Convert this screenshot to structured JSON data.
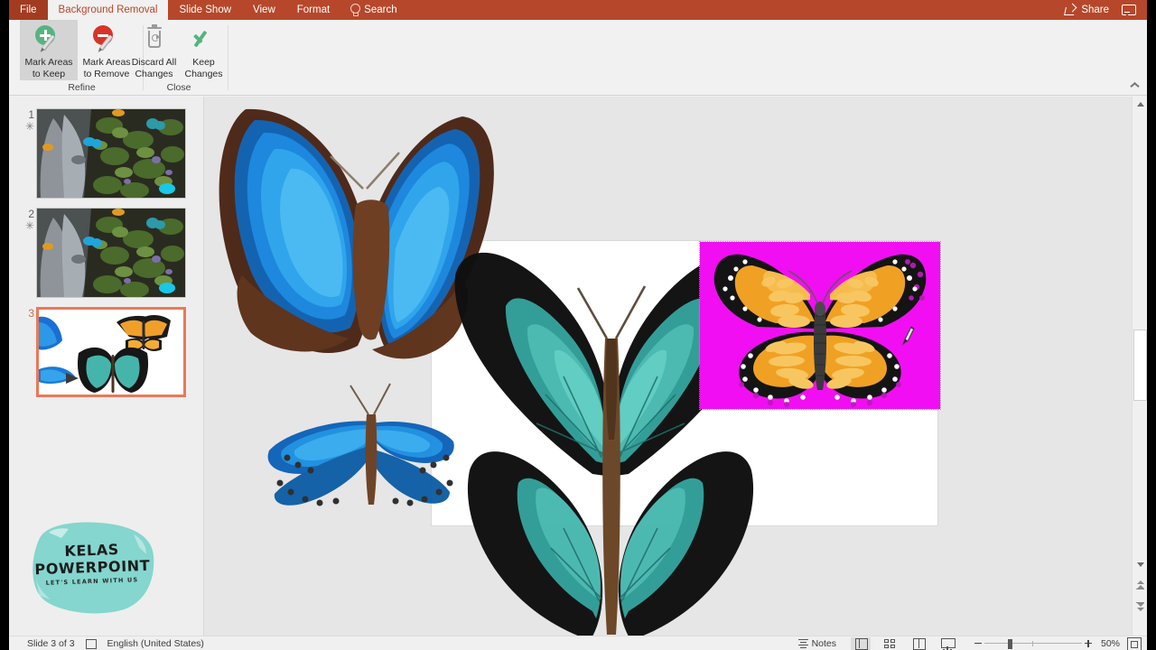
{
  "app": {
    "title": "Microsoft PowerPoint",
    "theme_color": "#b7472a",
    "accent_color": "#e8795a"
  },
  "tabs": [
    {
      "label": "File",
      "type": "file",
      "active": false
    },
    {
      "label": "Background Removal",
      "type": "normal",
      "active": true
    },
    {
      "label": "Slide Show",
      "type": "normal",
      "active": false
    },
    {
      "label": "View",
      "type": "normal",
      "active": false
    },
    {
      "label": "Format",
      "type": "normal",
      "active": false
    },
    {
      "label": "Search",
      "type": "search",
      "active": false,
      "icon": "lightbulb-icon"
    }
  ],
  "titlebar_right": {
    "share_label": "Share",
    "share_icon": "share-icon",
    "comments_icon": "comment-icon"
  },
  "ribbon": {
    "collapse_icon": "chevron-up-icon",
    "groups": [
      {
        "name": "Refine",
        "label": "Refine",
        "buttons": [
          {
            "label_line1": "Mark Areas",
            "label_line2": "to Keep",
            "icon": "mark-keep-icon",
            "selected": true
          },
          {
            "label_line1": "Mark Areas",
            "label_line2": "to Remove",
            "icon": "mark-remove-icon",
            "selected": false
          }
        ]
      },
      {
        "name": "Close",
        "label": "Close",
        "buttons": [
          {
            "label_line1": "Discard All",
            "label_line2": "Changes",
            "icon": "trash-icon",
            "selected": false
          },
          {
            "label_line1": "Keep",
            "label_line2": "Changes",
            "icon": "check-icon",
            "selected": false
          }
        ]
      }
    ]
  },
  "slide_panel": {
    "slides": [
      {
        "number": "1",
        "marker": "✳",
        "selected": false,
        "kind": "photo-butterflies-garden"
      },
      {
        "number": "2",
        "marker": "✳",
        "selected": false,
        "kind": "photo-butterflies-garden"
      },
      {
        "number": "3",
        "marker": "",
        "selected": true,
        "kind": "white-butterflies"
      }
    ]
  },
  "canvas": {
    "selected_image": {
      "name": "monarch-butterfly-image",
      "removal_overlay_color": "#f20ef2",
      "selection_style": "dotted",
      "state": "background-removal-preview"
    },
    "cursor": "pen-cursor"
  },
  "watermark": {
    "line1": "KELAS",
    "line2": "POWERPOINT",
    "tagline": "LET'S LEARN WITH US",
    "brush_color": "#84d6ce"
  },
  "scrollbar": {
    "up_icon": "scroll-up-icon",
    "down_icon": "scroll-down-icon",
    "prev_slide_icon": "previous-slide-icon",
    "next_slide_icon": "next-slide-icon"
  },
  "statusbar": {
    "slide_counter": "Slide 3 of 3",
    "accessibility_icon": "accessibility-checker-icon",
    "language": "English (United States)",
    "notes_label": "Notes",
    "notes_icon": "notes-icon",
    "views": [
      {
        "name": "normal-view",
        "icon": "normal-view-icon",
        "selected": true
      },
      {
        "name": "slide-sorter-view",
        "icon": "slide-sorter-icon",
        "selected": false
      },
      {
        "name": "reading-view",
        "icon": "reading-view-icon",
        "selected": false
      },
      {
        "name": "slide-show-view",
        "icon": "slide-show-icon",
        "selected": false
      }
    ],
    "zoom": {
      "minus_icon": "zoom-out-icon",
      "plus_icon": "zoom-in-icon",
      "percent": "50%",
      "fit_icon": "fit-slide-icon"
    }
  }
}
